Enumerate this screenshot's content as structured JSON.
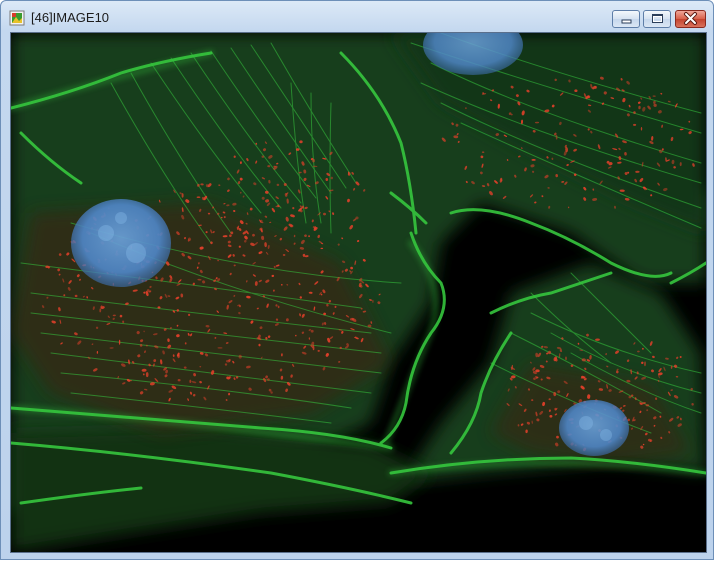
{
  "window": {
    "title": "[46]IMAGE10",
    "icon": "image-document-icon",
    "controls": {
      "minimize_icon": "minimize-icon",
      "maximize_icon": "maximize-icon",
      "close_icon": "close-icon"
    }
  },
  "image": {
    "subject": "fluorescence-micrograph",
    "colors": {
      "background": "#000000",
      "actin": "#2fbf3a",
      "mitochondria": "#e4402a",
      "nuclei": "#4f86c6"
    }
  }
}
